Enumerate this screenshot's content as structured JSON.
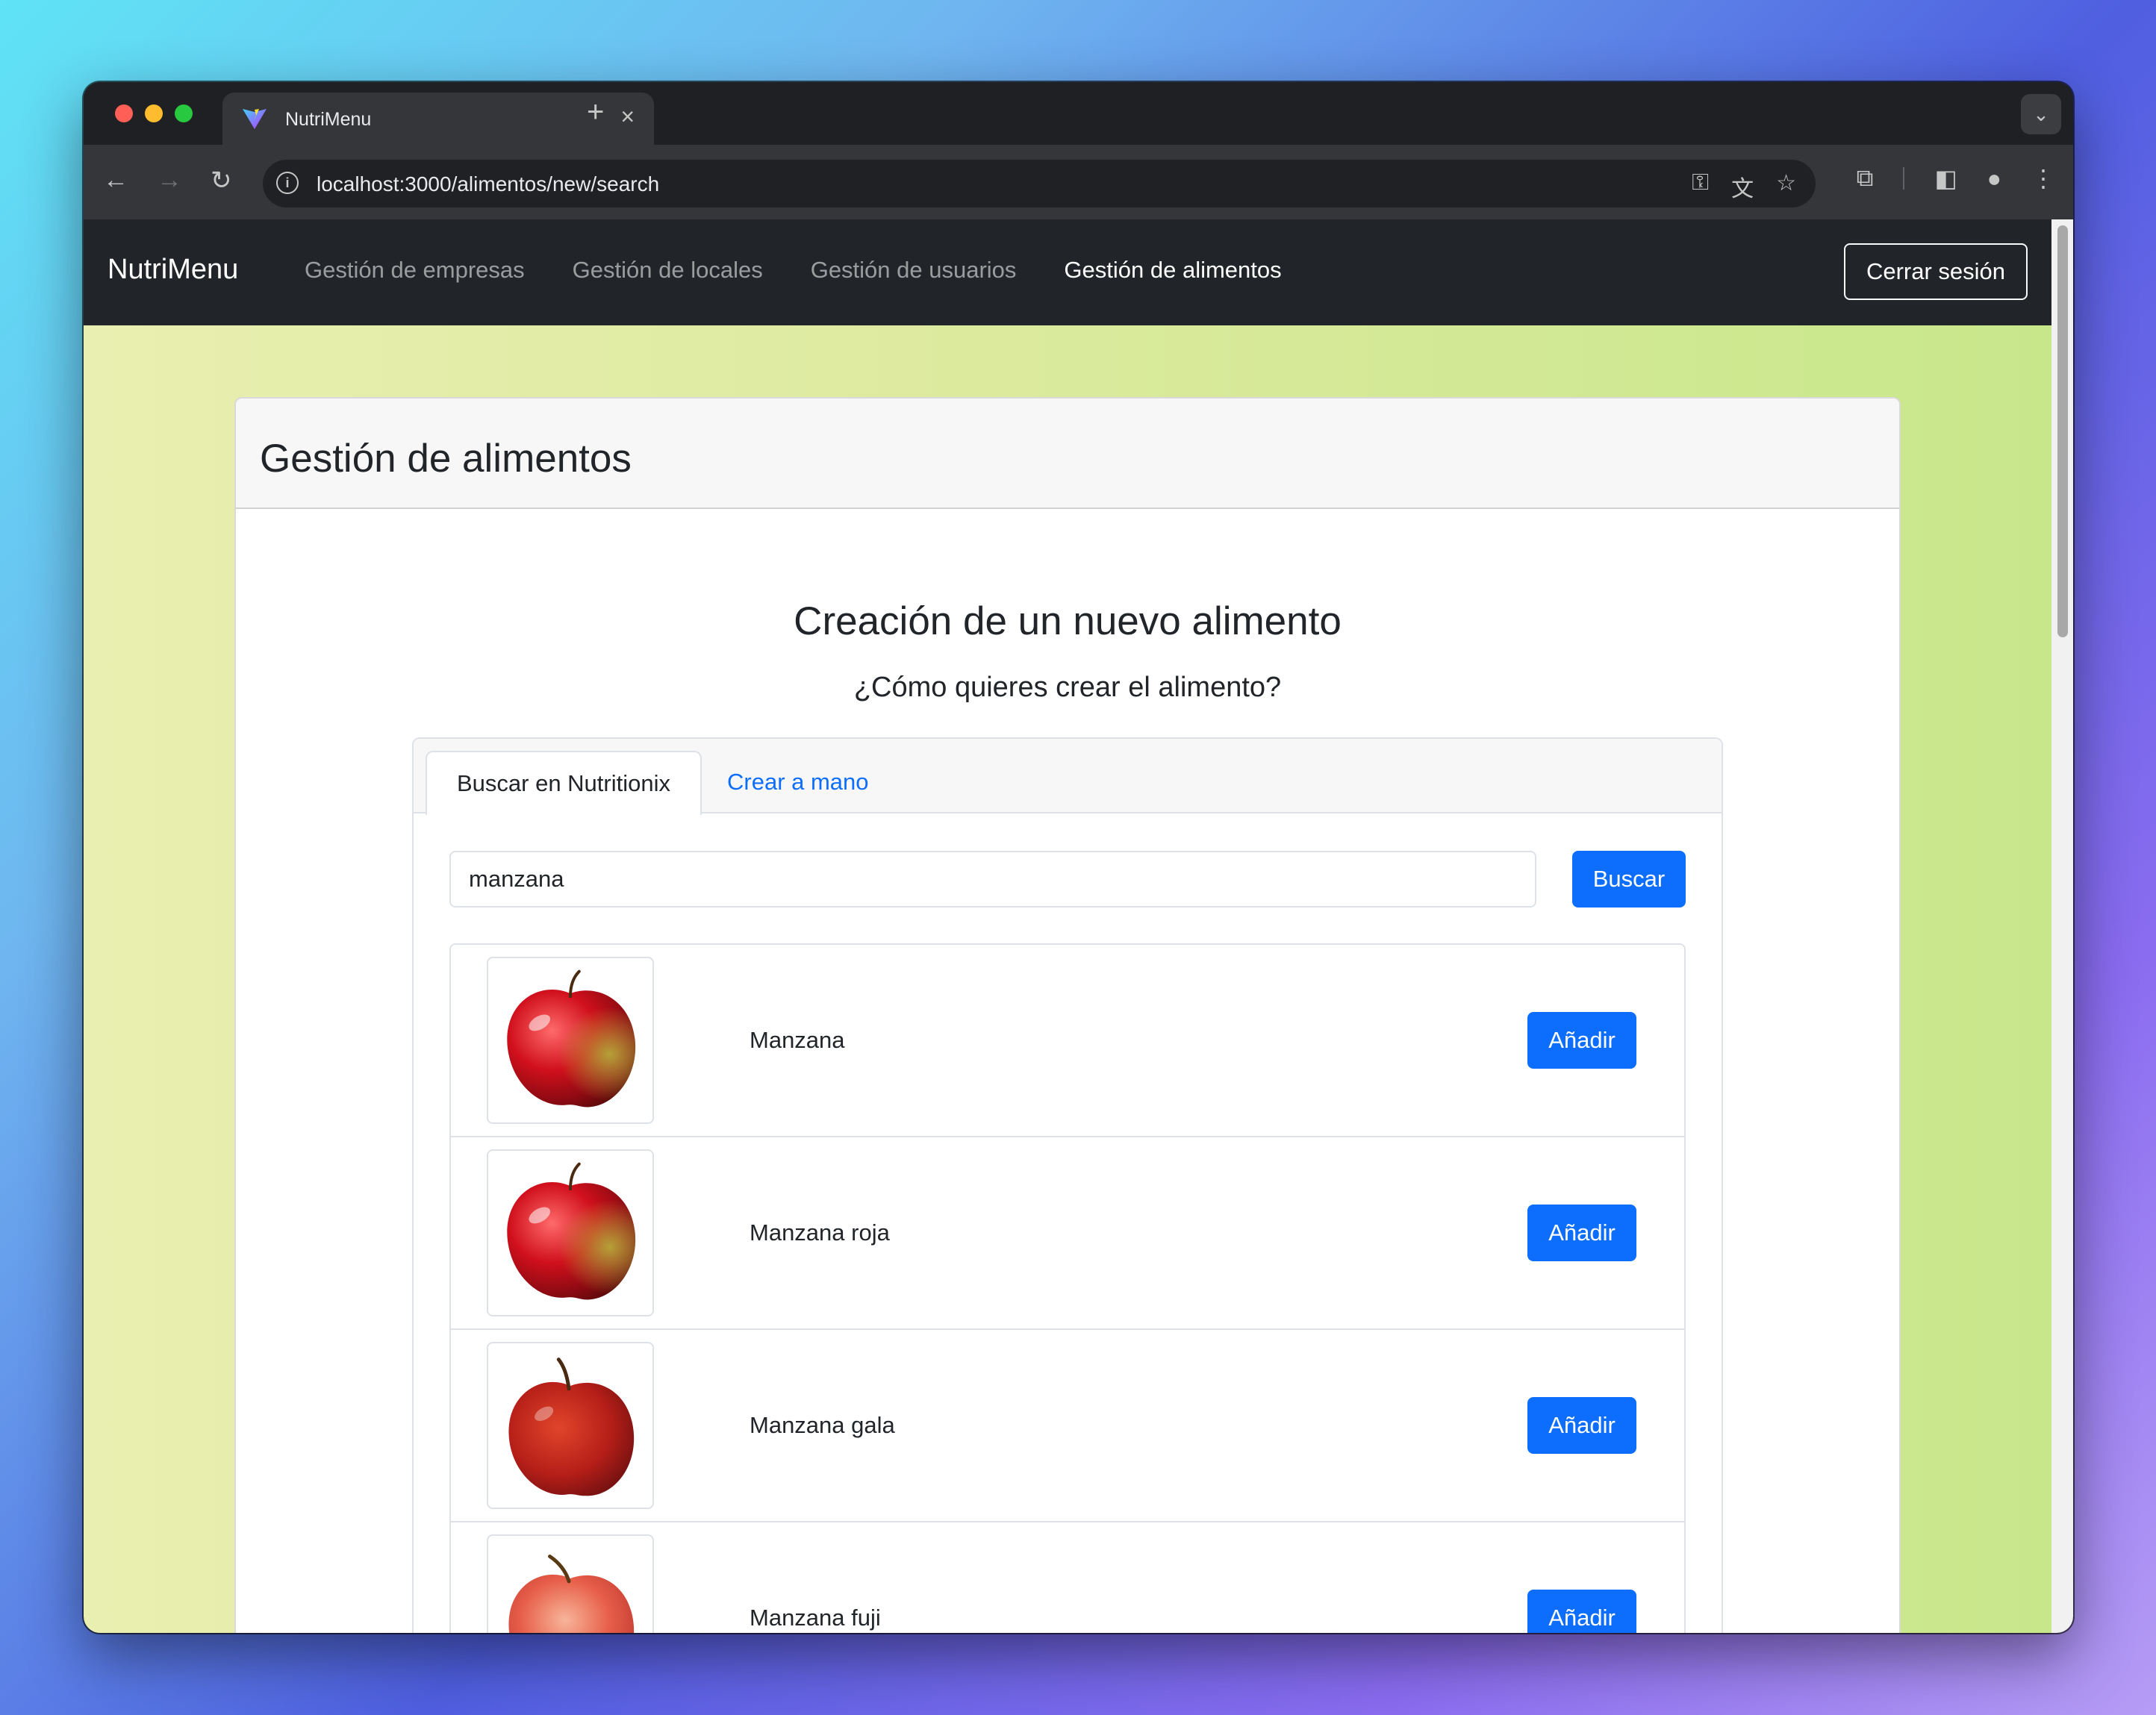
{
  "browser": {
    "tab_title": "NutriMenu",
    "url": "localhost:3000/alimentos/new/search"
  },
  "navbar": {
    "brand": "NutriMenu",
    "links": [
      {
        "label": "Gestión de empresas",
        "active": false
      },
      {
        "label": "Gestión de locales",
        "active": false
      },
      {
        "label": "Gestión de usuarios",
        "active": false
      },
      {
        "label": "Gestión de alimentos",
        "active": true
      }
    ],
    "logout_label": "Cerrar sesión"
  },
  "card": {
    "title": "Gestión de alimentos"
  },
  "main": {
    "heading": "Creación de un nuevo alimento",
    "subheading": "¿Cómo quieres crear el alimento?",
    "tabs": [
      {
        "label": "Buscar en Nutritionix",
        "active": true
      },
      {
        "label": "Crear a mano",
        "active": false
      }
    ],
    "search": {
      "value": "manzana",
      "button_label": "Buscar"
    },
    "results": [
      {
        "name": "Manzana",
        "button_label": "Añadir",
        "image": "red-green-apple"
      },
      {
        "name": "Manzana roja",
        "button_label": "Añadir",
        "image": "red-green-apple"
      },
      {
        "name": "Manzana gala",
        "button_label": "Añadir",
        "image": "red-apple"
      },
      {
        "name": "Manzana fuji",
        "button_label": "Añadir",
        "image": "pink-apple"
      }
    ]
  },
  "colors": {
    "primary": "#0d6efd",
    "navbar_bg": "#212529",
    "link_color": "#0d6efd"
  }
}
